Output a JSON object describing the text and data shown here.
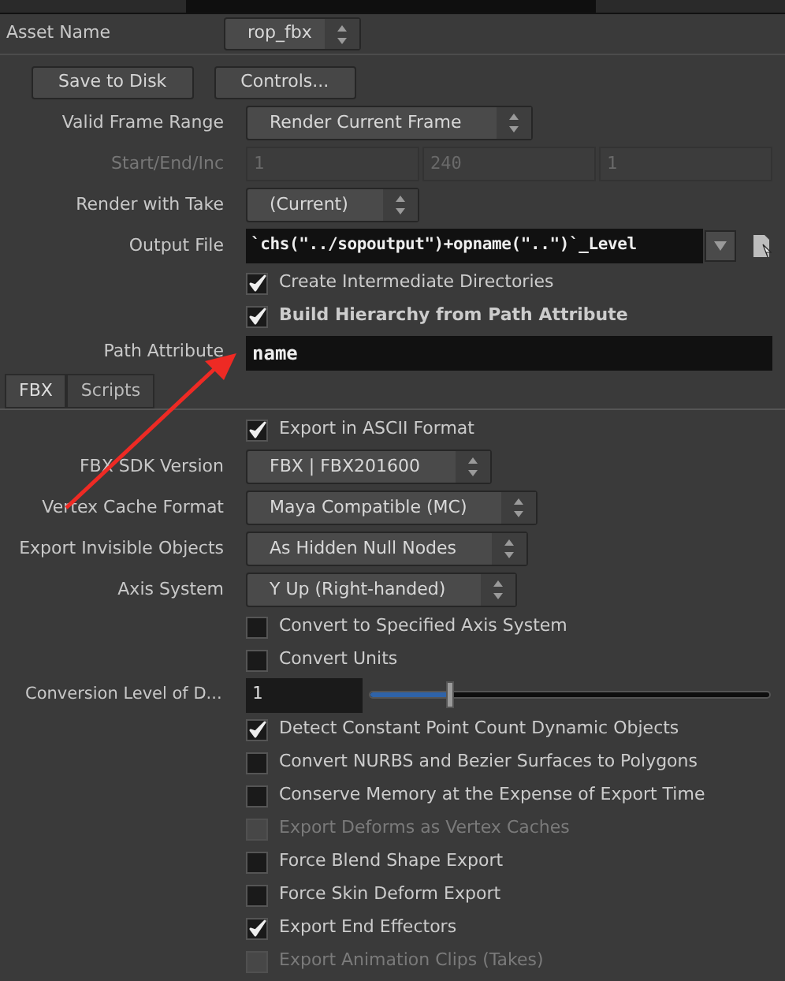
{
  "asset": {
    "label": "Asset Name",
    "value": "rop_fbx"
  },
  "buttons": [
    "Save to Disk",
    "Controls..."
  ],
  "params": [
    {
      "kind": "menu",
      "label": "Valid Frame Range",
      "value": "Render Current Frame"
    },
    {
      "kind": "triple",
      "label": "Start/End/Inc",
      "values": [
        "1",
        "240",
        "1"
      ],
      "disabled": true
    },
    {
      "kind": "menu",
      "label": "Render with Take",
      "value": "(Current)"
    },
    {
      "kind": "file",
      "label": "Output File",
      "value": "`chs(\"../sopoutput\")+opname(\"..\")`_Level"
    },
    {
      "kind": "checkbox",
      "label": "Create Intermediate Directories",
      "checked": true,
      "disabled": false,
      "bold": false
    },
    {
      "kind": "checkbox",
      "label": "Build Hierarchy from Path Attribute",
      "checked": true,
      "disabled": false,
      "bold": true
    },
    {
      "kind": "field",
      "label": "Path Attribute",
      "value": "name"
    }
  ],
  "tabs": [
    {
      "label": "FBX",
      "selected": true
    },
    {
      "label": "Scripts",
      "selected": false
    }
  ],
  "fbx_params": [
    {
      "kind": "checkbox",
      "label": "Export in ASCII Format",
      "checked": true,
      "disabled": false
    },
    {
      "kind": "menu",
      "label": "FBX SDK Version",
      "value": "FBX | FBX201600"
    },
    {
      "kind": "menu",
      "label": "Vertex Cache Format",
      "value": "Maya Compatible (MC)"
    },
    {
      "kind": "menu",
      "label": "Export Invisible Objects",
      "value": "As Hidden Null Nodes"
    },
    {
      "kind": "menu",
      "label": "Axis System",
      "value": "Y Up (Right-handed)"
    },
    {
      "kind": "checkbox",
      "label": "Convert to Specified Axis System",
      "checked": false,
      "disabled": false
    },
    {
      "kind": "checkbox",
      "label": "Convert Units",
      "checked": false,
      "disabled": false
    },
    {
      "kind": "slider",
      "label": "Conversion Level of D...",
      "value": "1",
      "level": 0.2
    },
    {
      "kind": "checkbox",
      "label": "Detect Constant Point Count Dynamic Objects",
      "checked": true,
      "disabled": false
    },
    {
      "kind": "checkbox",
      "label": "Convert NURBS and Bezier Surfaces to Polygons",
      "checked": false,
      "disabled": false
    },
    {
      "kind": "checkbox",
      "label": "Conserve Memory at the Expense of Export Time",
      "checked": false,
      "disabled": false
    },
    {
      "kind": "checkbox",
      "label": "Export Deforms as Vertex Caches",
      "checked": false,
      "disabled": true
    },
    {
      "kind": "checkbox",
      "label": "Force Blend Shape Export",
      "checked": false,
      "disabled": false
    },
    {
      "kind": "checkbox",
      "label": "Force Skin Deform Export",
      "checked": false,
      "disabled": false
    },
    {
      "kind": "checkbox",
      "label": "Export End Effectors",
      "checked": true,
      "disabled": false
    },
    {
      "kind": "checkbox",
      "label": "Export Animation Clips (Takes)",
      "checked": false,
      "disabled": true
    }
  ]
}
